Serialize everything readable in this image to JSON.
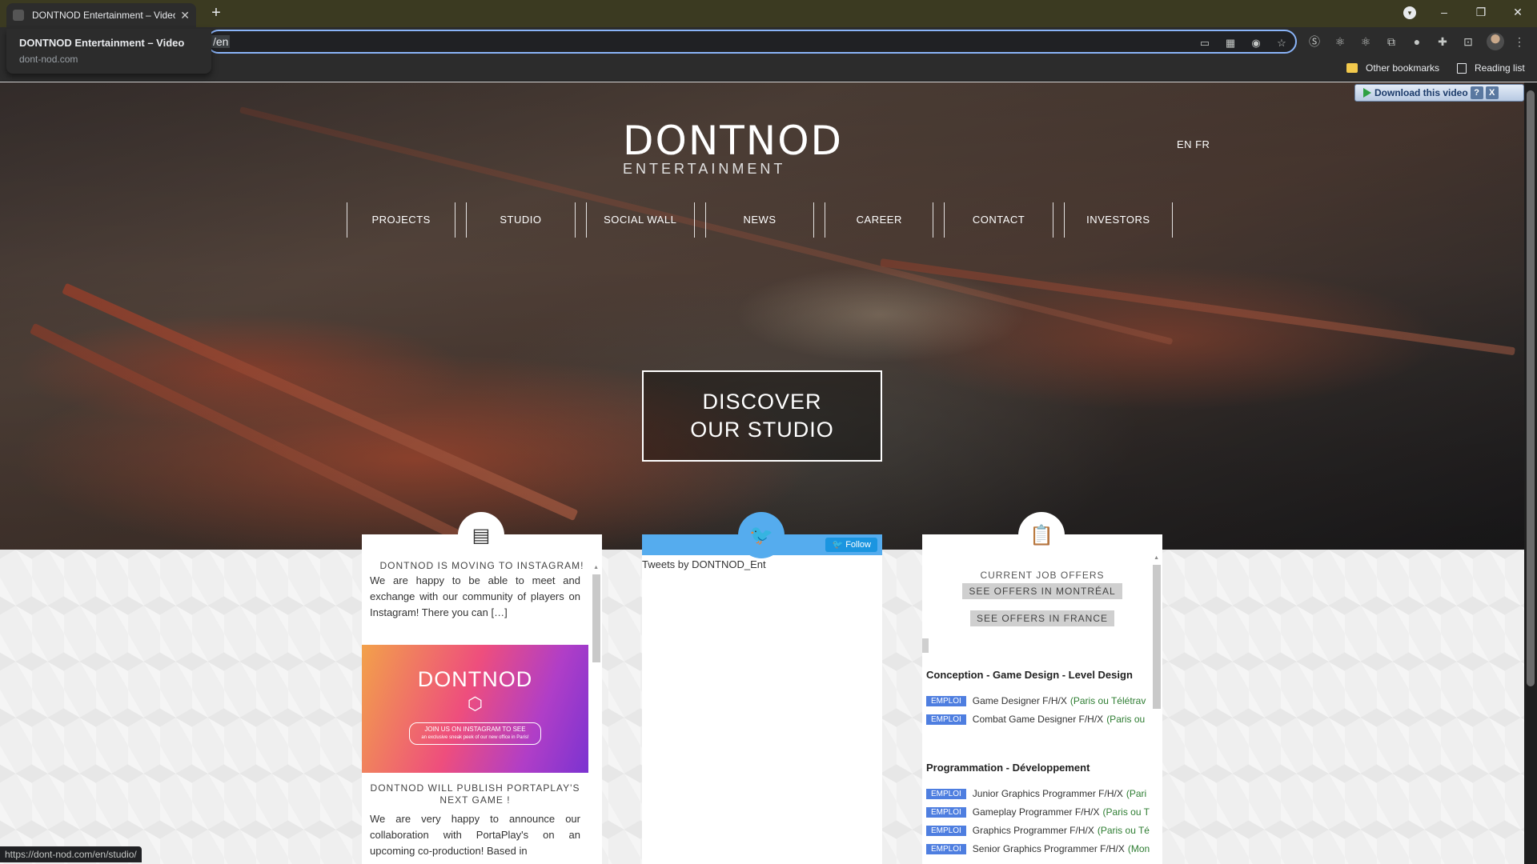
{
  "browser": {
    "tab_title": "DONTNOD Entertainment – Video",
    "new_tab": "+",
    "url_fragment": "/en",
    "hovercard_title": "DONTNOD Entertainment – Video",
    "hovercard_domain": "dont-nod.com",
    "bookmarks": {
      "other": "Other bookmarks",
      "reading_list": "Reading list"
    },
    "status_url": "https://dont-nod.com/en/studio/",
    "window": {
      "minimize": "–",
      "restore": "❐",
      "close": "✕"
    }
  },
  "download_widget": {
    "label": "Download this video",
    "help": "?",
    "close": "X"
  },
  "site": {
    "logo_main": "DONTNOD",
    "logo_sub": "ENTERTAINMENT",
    "lang": {
      "en": "EN",
      "fr": "FR"
    },
    "nav": [
      "PROJECTS",
      "STUDIO",
      "SOCIAL WALL",
      "NEWS",
      "CAREER",
      "CONTACT",
      "INVESTORS"
    ],
    "discover": {
      "line1": "DISCOVER",
      "line2": "OUR STUDIO"
    }
  },
  "news": {
    "item1_title": "DONTNOD is moving to Instagram!",
    "item1_text": "We are happy to be able to meet and exchange with our community of players on Instagram! There you can […]",
    "image": {
      "brand": "DONTNOD",
      "pill_l1": "JOIN US ON INSTAGRAM TO SEE",
      "pill_l2": "an exclusive sneak peek of our new office in Paris!"
    },
    "item2_title": "DONTNOD will publish PortaPlay's next game !",
    "item2_text": "We are very happy to announce our collaboration with PortaPlay's on an upcoming co-production! Based in"
  },
  "twitter": {
    "follow": "Follow",
    "caption": "Tweets by DONTNOD_Ent"
  },
  "career": {
    "title": "CURRENT JOB OFFERS",
    "btn_montreal": "SEE OFFERS IN MONTRÉAL",
    "btn_france": "SEE OFFERS IN FRANCE",
    "cat1": "Conception - Game Design - Level Design",
    "cat2": "Programmation - Développement",
    "badge": "EMPLOI",
    "jobs1": [
      {
        "title": "Game Designer F/H/X",
        "loc": "(Paris ou Télétrav"
      },
      {
        "title": "Combat Game Designer F/H/X",
        "loc": "(Paris ou"
      }
    ],
    "jobs2": [
      {
        "title": "Junior Graphics Programmer F/H/X",
        "loc": "(Pari"
      },
      {
        "title": "Gameplay Programmer F/H/X",
        "loc": "(Paris ou T"
      },
      {
        "title": "Graphics Programmer F/H/X",
        "loc": "(Paris ou Té"
      },
      {
        "title": "Senior Graphics Programmer F/H/X",
        "loc": "(Mon"
      }
    ]
  }
}
